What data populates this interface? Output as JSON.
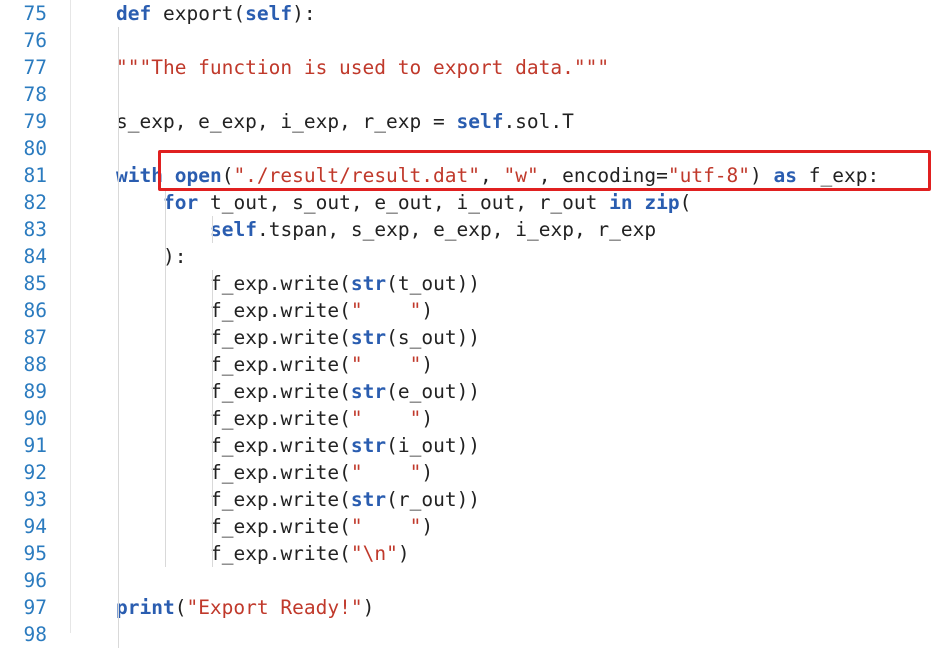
{
  "lines": [
    {
      "n": "75",
      "indent": 0,
      "tokens": [
        {
          "t": "def",
          "c": "kw"
        },
        {
          "t": " export("
        },
        {
          "t": "self",
          "c": "kw"
        },
        {
          "t": "):"
        }
      ]
    },
    {
      "n": "76",
      "indent": 0,
      "tokens": []
    },
    {
      "n": "77",
      "indent": 1,
      "tokens": [
        {
          "t": "\"\"\"The function is used to export data.\"\"\"",
          "c": "st"
        }
      ]
    },
    {
      "n": "78",
      "indent": 0,
      "tokens": []
    },
    {
      "n": "79",
      "indent": 1,
      "tokens": [
        {
          "t": "s_exp, e_exp, i_exp, r_exp = "
        },
        {
          "t": "self",
          "c": "kw"
        },
        {
          "t": ".sol.T"
        }
      ]
    },
    {
      "n": "80",
      "indent": 0,
      "tokens": []
    },
    {
      "n": "81",
      "indent": 1,
      "tokens": [
        {
          "t": "with",
          "c": "kw"
        },
        {
          "t": " "
        },
        {
          "t": "open",
          "c": "fn"
        },
        {
          "t": "("
        },
        {
          "t": "\"./result/result.dat\"",
          "c": "st"
        },
        {
          "t": ", "
        },
        {
          "t": "\"w\"",
          "c": "st"
        },
        {
          "t": ", encoding="
        },
        {
          "t": "\"utf-8\"",
          "c": "st"
        },
        {
          "t": ") "
        },
        {
          "t": "as",
          "c": "kw"
        },
        {
          "t": " f_exp:"
        }
      ]
    },
    {
      "n": "82",
      "indent": 2,
      "tokens": [
        {
          "t": "for",
          "c": "kw"
        },
        {
          "t": " t_out, s_out, e_out, i_out, r_out "
        },
        {
          "t": "in",
          "c": "kw"
        },
        {
          "t": " "
        },
        {
          "t": "zip",
          "c": "fn"
        },
        {
          "t": "("
        }
      ]
    },
    {
      "n": "83",
      "indent": 3,
      "tokens": [
        {
          "t": "self",
          "c": "kw"
        },
        {
          "t": ".tspan, s_exp, e_exp, i_exp, r_exp"
        }
      ]
    },
    {
      "n": "84",
      "indent": 2,
      "tokens": [
        {
          "t": "):"
        }
      ]
    },
    {
      "n": "85",
      "indent": 3,
      "tokens": [
        {
          "t": "f_exp.write("
        },
        {
          "t": "str",
          "c": "fn"
        },
        {
          "t": "(t_out))"
        }
      ]
    },
    {
      "n": "86",
      "indent": 3,
      "tokens": [
        {
          "t": "f_exp.write("
        },
        {
          "t": "\"    \"",
          "c": "st"
        },
        {
          "t": ")"
        }
      ]
    },
    {
      "n": "87",
      "indent": 3,
      "tokens": [
        {
          "t": "f_exp.write("
        },
        {
          "t": "str",
          "c": "fn"
        },
        {
          "t": "(s_out))"
        }
      ]
    },
    {
      "n": "88",
      "indent": 3,
      "tokens": [
        {
          "t": "f_exp.write("
        },
        {
          "t": "\"    \"",
          "c": "st"
        },
        {
          "t": ")"
        }
      ]
    },
    {
      "n": "89",
      "indent": 3,
      "tokens": [
        {
          "t": "f_exp.write("
        },
        {
          "t": "str",
          "c": "fn"
        },
        {
          "t": "(e_out))"
        }
      ]
    },
    {
      "n": "90",
      "indent": 3,
      "tokens": [
        {
          "t": "f_exp.write("
        },
        {
          "t": "\"    \"",
          "c": "st"
        },
        {
          "t": ")"
        }
      ]
    },
    {
      "n": "91",
      "indent": 3,
      "tokens": [
        {
          "t": "f_exp.write("
        },
        {
          "t": "str",
          "c": "fn"
        },
        {
          "t": "(i_out))"
        }
      ]
    },
    {
      "n": "92",
      "indent": 3,
      "tokens": [
        {
          "t": "f_exp.write("
        },
        {
          "t": "\"    \"",
          "c": "st"
        },
        {
          "t": ")"
        }
      ]
    },
    {
      "n": "93",
      "indent": 3,
      "tokens": [
        {
          "t": "f_exp.write("
        },
        {
          "t": "str",
          "c": "fn"
        },
        {
          "t": "(r_out))"
        }
      ]
    },
    {
      "n": "94",
      "indent": 3,
      "tokens": [
        {
          "t": "f_exp.write("
        },
        {
          "t": "\"    \"",
          "c": "st"
        },
        {
          "t": ")"
        }
      ]
    },
    {
      "n": "95",
      "indent": 3,
      "tokens": [
        {
          "t": "f_exp.write("
        },
        {
          "t": "\"\\n\"",
          "c": "st"
        },
        {
          "t": ")"
        }
      ]
    },
    {
      "n": "96",
      "indent": 0,
      "tokens": []
    },
    {
      "n": "97",
      "indent": 1,
      "tokens": [
        {
          "t": "print",
          "c": "fn"
        },
        {
          "t": "("
        },
        {
          "t": "\"Export Ready!\"",
          "c": "st"
        },
        {
          "t": ")"
        }
      ]
    },
    {
      "n": "98",
      "indent": 0,
      "tokens": []
    }
  ],
  "colors": {
    "line_number": "#2b7bbf",
    "keyword": "#2a5db0",
    "string": "#c0392b",
    "highlight_border": "#e02020"
  },
  "highlight": {
    "line": "81",
    "label": "highlighted-with-open-statement"
  }
}
